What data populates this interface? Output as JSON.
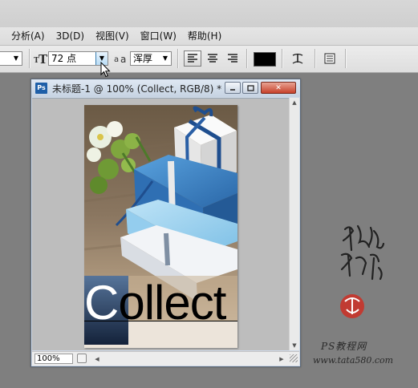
{
  "menu": {
    "items": [
      "分析(A)",
      "3D(D)",
      "视图(V)",
      "窗口(W)",
      "帮助(H)"
    ]
  },
  "options": {
    "font_size": "72 点",
    "antialias": "浑厚",
    "color": "#000000"
  },
  "document": {
    "title": "未标题-1 @ 100% (Collect, RGB/8) *",
    "ps_badge": "Ps",
    "zoom": "100%",
    "artwork_text": "Collect",
    "artwork_cap": "C",
    "artwork_rest": "ollect"
  },
  "watermark": {
    "line1": "PS教程网",
    "line2": "www.tata580.com"
  },
  "colors": {
    "background": "#7f7f7f",
    "window_title": "#c6d3e2",
    "close_button": "#c7412b",
    "box_blue": "#3a7fc1"
  },
  "icons": [
    "text-orientation-icon",
    "font-size-icon",
    "antialias-icon",
    "align-left-icon",
    "align-center-icon",
    "align-right-icon",
    "warp-text-icon",
    "panels-icon",
    "cursor-icon"
  ]
}
